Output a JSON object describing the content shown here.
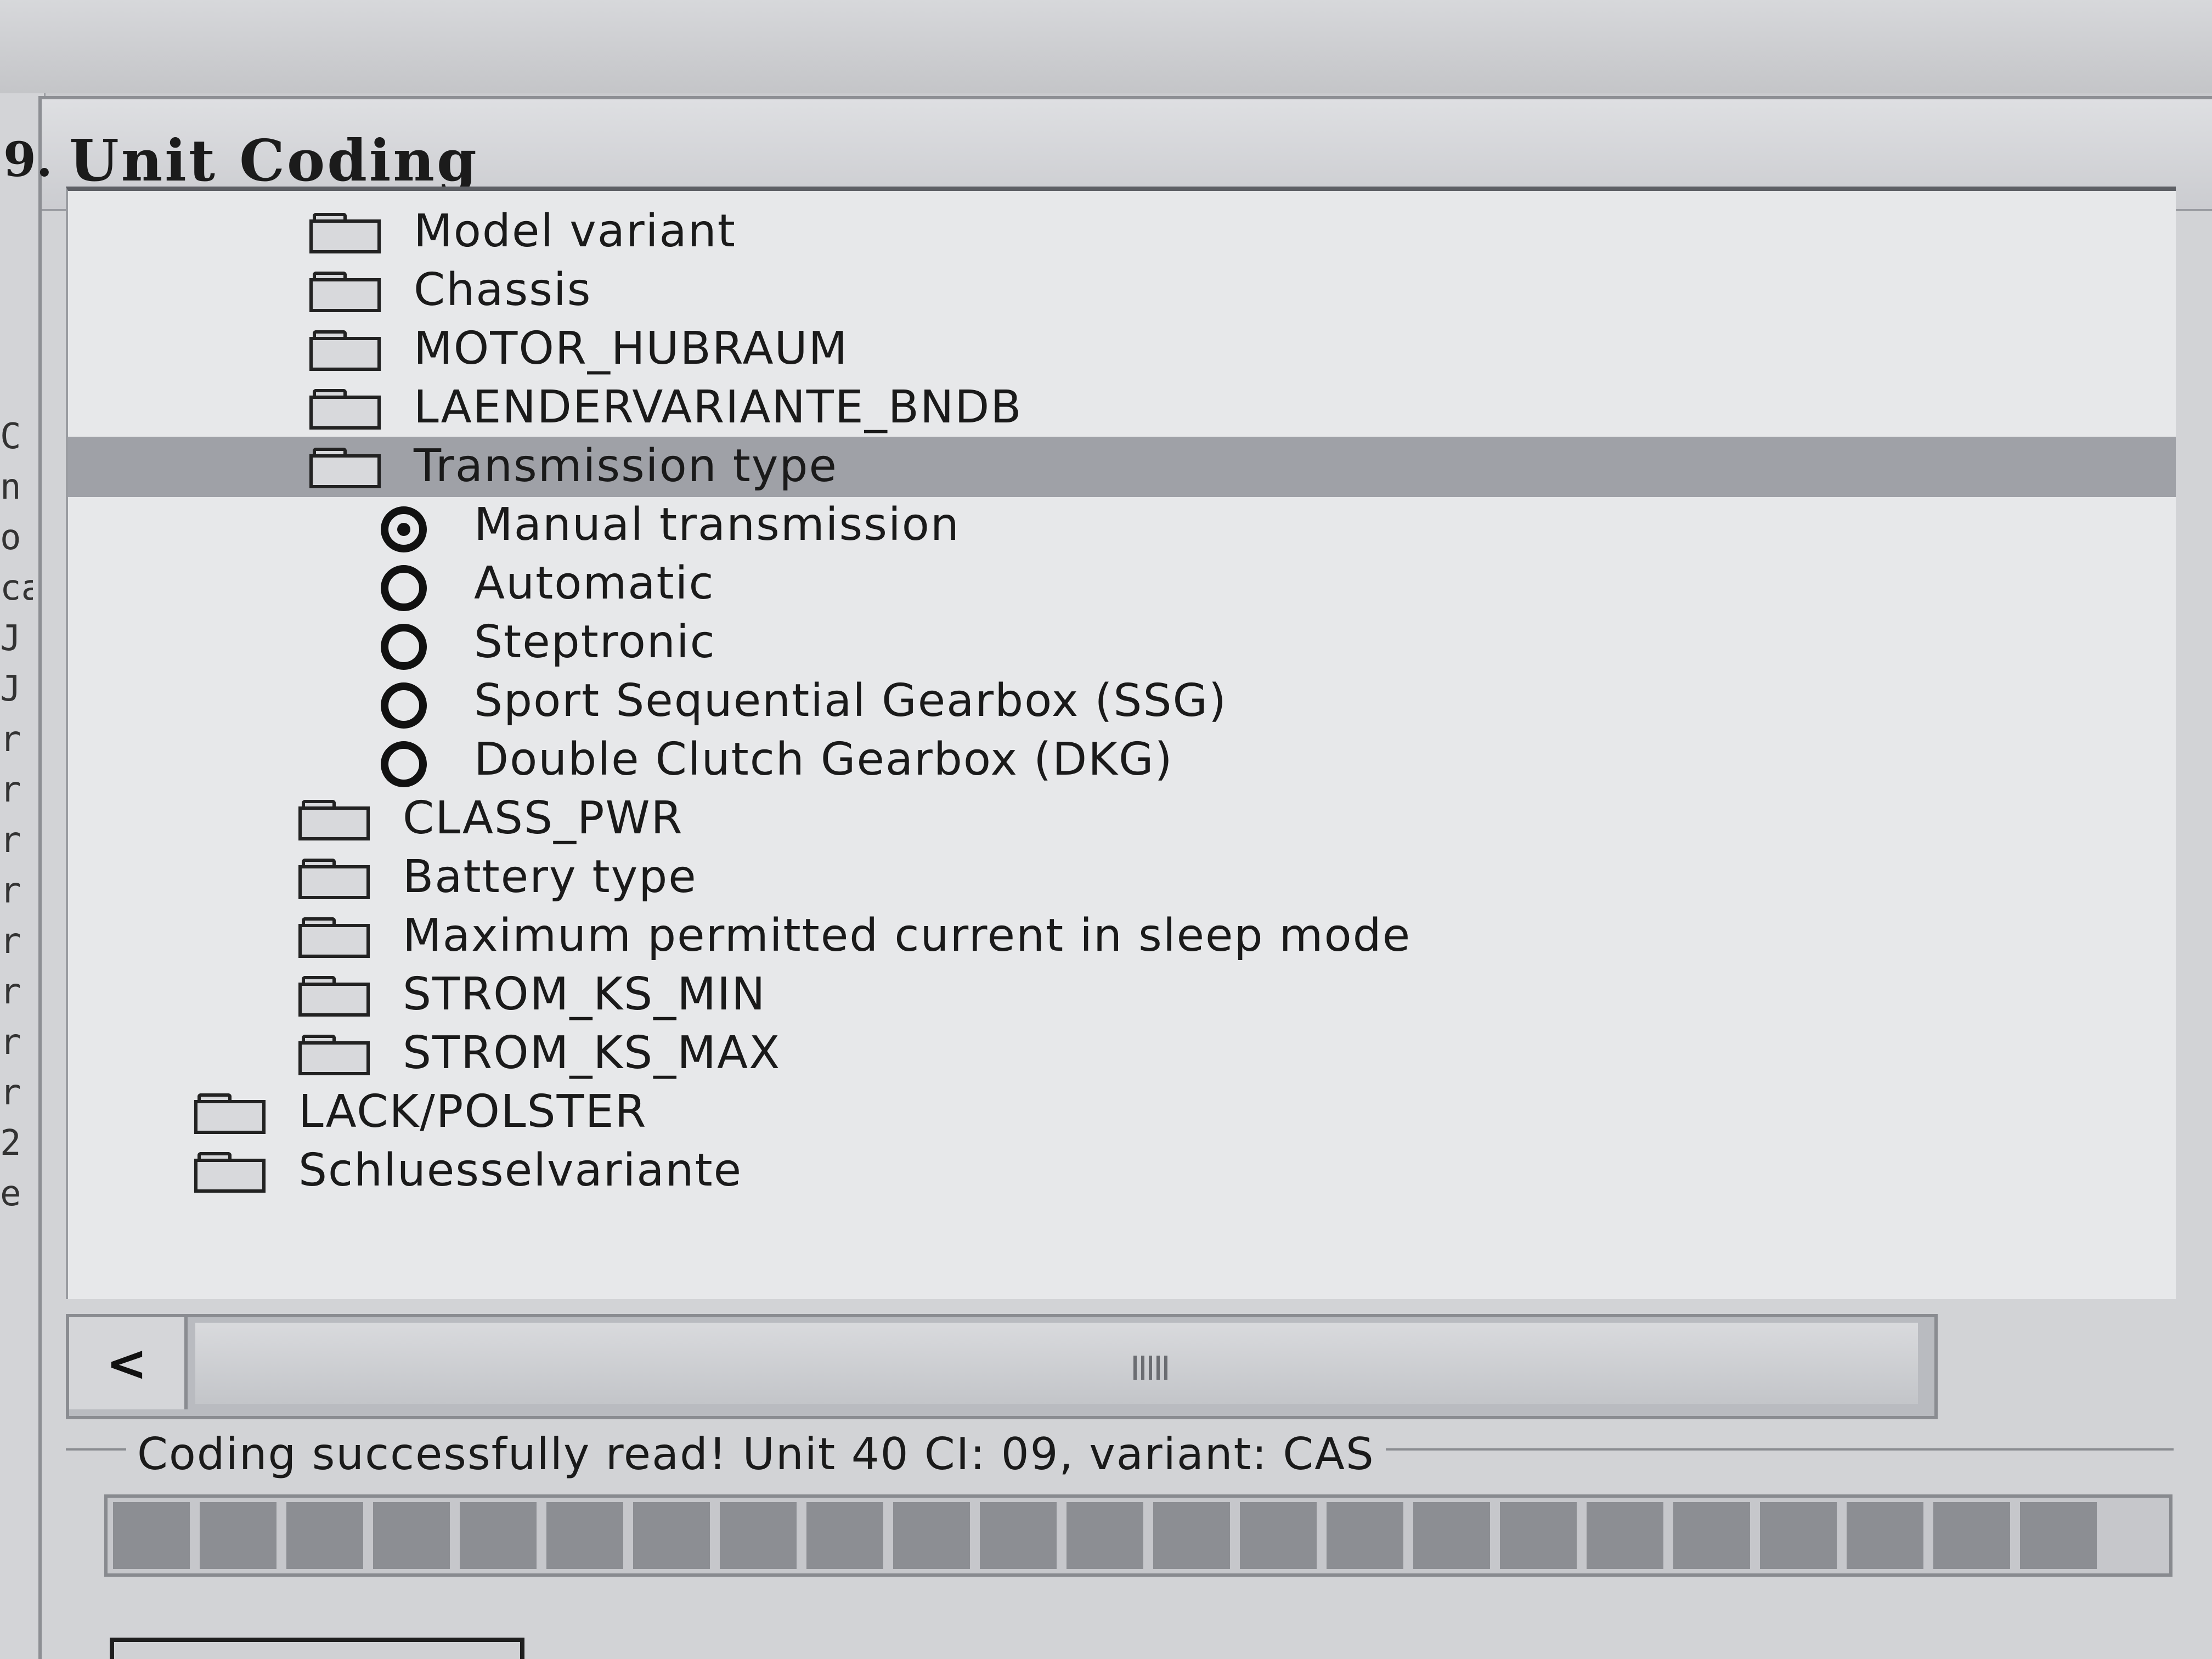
{
  "left_edge": {
    "title_prefix": "9.",
    "glyphs": [
      "C",
      "n",
      "o",
      "ca",
      "J",
      "J",
      "r",
      "r",
      "r",
      "r",
      "r",
      "r",
      "r",
      "r",
      "2",
      "e"
    ]
  },
  "dialog": {
    "title": "Unit Coding"
  },
  "tree": {
    "items": [
      {
        "kind": "folder",
        "label": "Model variant"
      },
      {
        "kind": "folder",
        "label": "Chassis"
      },
      {
        "kind": "folder",
        "label": "MOTOR_HUBRAUM"
      },
      {
        "kind": "folder",
        "label": "LAENDERVARIANTE_BNDB"
      },
      {
        "kind": "folder",
        "label": "Transmission type",
        "selected": true
      },
      {
        "kind": "radio",
        "label": "Manual transmission",
        "checked": true
      },
      {
        "kind": "radio",
        "label": "Automatic",
        "checked": false
      },
      {
        "kind": "radio",
        "label": "Steptronic",
        "checked": false
      },
      {
        "kind": "radio",
        "label": "Sport Sequential Gearbox (SSG)",
        "checked": false
      },
      {
        "kind": "radio",
        "label": "Double Clutch Gearbox (DKG)",
        "checked": false
      },
      {
        "kind": "folder",
        "label": "CLASS_PWR"
      },
      {
        "kind": "folder",
        "label": "Battery type"
      },
      {
        "kind": "folder",
        "label": "Maximum permitted current in sleep mode"
      },
      {
        "kind": "folder",
        "label": "STROM_KS_MIN"
      },
      {
        "kind": "folder",
        "label": "STROM_KS_MAX"
      },
      {
        "kind": "folder",
        "label": "LACK/POLSTER"
      },
      {
        "kind": "folder",
        "label": "Schluesselvariante"
      }
    ]
  },
  "scrollbar": {
    "left_arrow": "<"
  },
  "status": {
    "message": "Coding successfully read! Unit 40 CI: 09, variant: CAS"
  },
  "progress": {
    "fraction": 1.0
  }
}
